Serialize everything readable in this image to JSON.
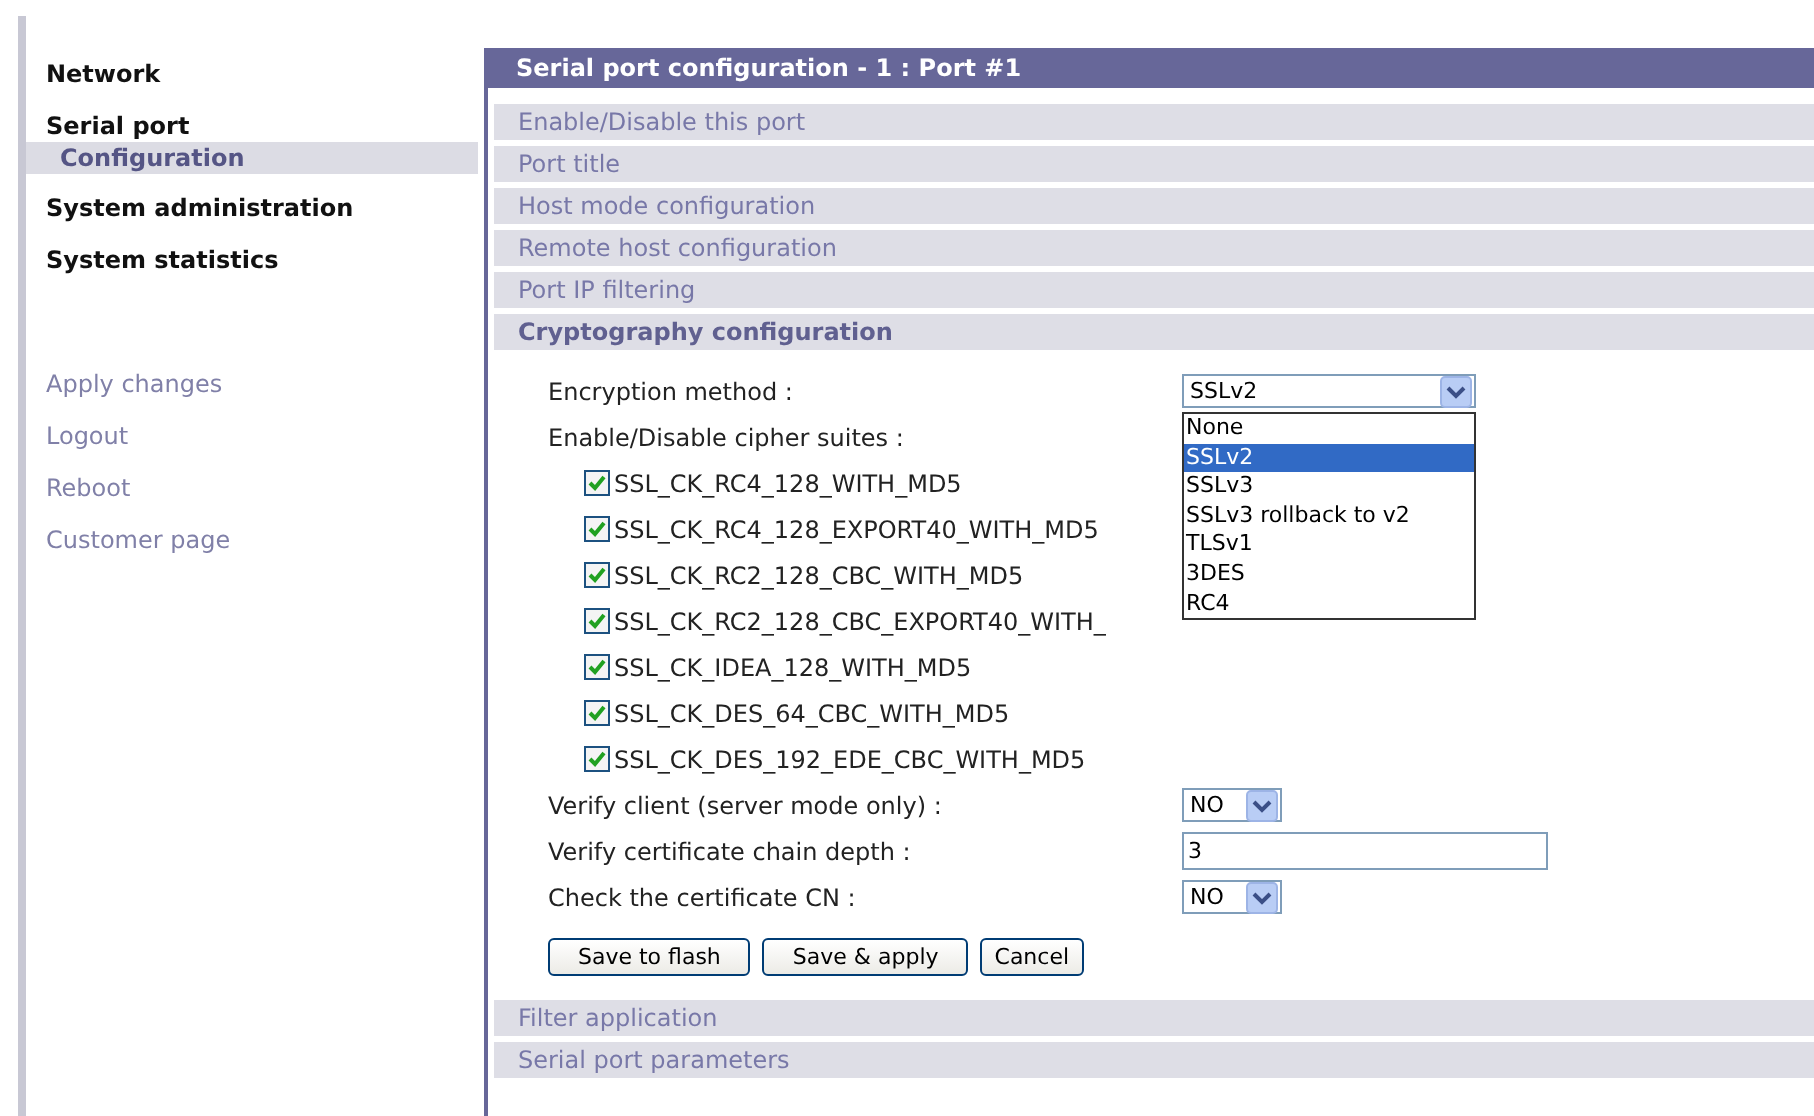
{
  "sidebar": {
    "menu": [
      {
        "label": "Network",
        "kind": "heading",
        "selected": false
      },
      {
        "label": "Serial port",
        "kind": "heading",
        "selected": false
      },
      {
        "label": "Configuration",
        "kind": "sub",
        "selected": true
      },
      {
        "label": "System administration",
        "kind": "heading",
        "selected": false
      },
      {
        "label": "System statistics",
        "kind": "heading",
        "selected": false
      }
    ],
    "links": [
      "Apply changes",
      "Logout",
      "Reboot",
      "Customer page"
    ]
  },
  "panel": {
    "title": "Serial port configuration - 1 : Port #1",
    "sections": [
      {
        "label": "Enable/Disable this port",
        "expanded": false
      },
      {
        "label": "Port title",
        "expanded": false
      },
      {
        "label": "Host mode configuration",
        "expanded": false
      },
      {
        "label": "Remote host configuration",
        "expanded": false
      },
      {
        "label": "Port IP filtering",
        "expanded": false
      },
      {
        "label": "Cryptography configuration",
        "expanded": true,
        "form": {
          "encryption": {
            "label": "Encryption method :",
            "value": "SSLv2",
            "open": true,
            "options": [
              {
                "label": "None",
                "selected": false
              },
              {
                "label": "SSLv2",
                "selected": true
              },
              {
                "label": "SSLv3",
                "selected": false
              },
              {
                "label": "SSLv3 rollback to v2",
                "selected": false
              },
              {
                "label": "TLSv1",
                "selected": false
              },
              {
                "label": "3DES",
                "selected": false
              },
              {
                "label": "RC4",
                "selected": false
              }
            ]
          },
          "cipher_label": "Enable/Disable cipher suites :",
          "ciphers": [
            {
              "label": "SSL_CK_RC4_128_WITH_MD5",
              "checked": true
            },
            {
              "label": "SSL_CK_RC4_128_EXPORT40_WITH_MD5",
              "checked": true
            },
            {
              "label": "SSL_CK_RC2_128_CBC_WITH_MD5",
              "checked": true
            },
            {
              "label": "SSL_CK_RC2_128_CBC_EXPORT40_WITH_",
              "checked": true
            },
            {
              "label": "SSL_CK_IDEA_128_WITH_MD5",
              "checked": true
            },
            {
              "label": "SSL_CK_DES_64_CBC_WITH_MD5",
              "checked": true
            },
            {
              "label": "SSL_CK_DES_192_EDE_CBC_WITH_MD5",
              "checked": true
            }
          ],
          "verify_client": {
            "label": "Verify client (server mode only) :",
            "value": "NO"
          },
          "chain_depth": {
            "label": "Verify certificate chain depth :",
            "value": "3"
          },
          "check_cn": {
            "label": "Check the certificate CN :",
            "value": "NO"
          },
          "buttons": [
            "Save to flash",
            "Save & apply",
            "Cancel"
          ]
        }
      },
      {
        "label": "Filter application",
        "expanded": false
      },
      {
        "label": "Serial port parameters",
        "expanded": false
      }
    ]
  }
}
